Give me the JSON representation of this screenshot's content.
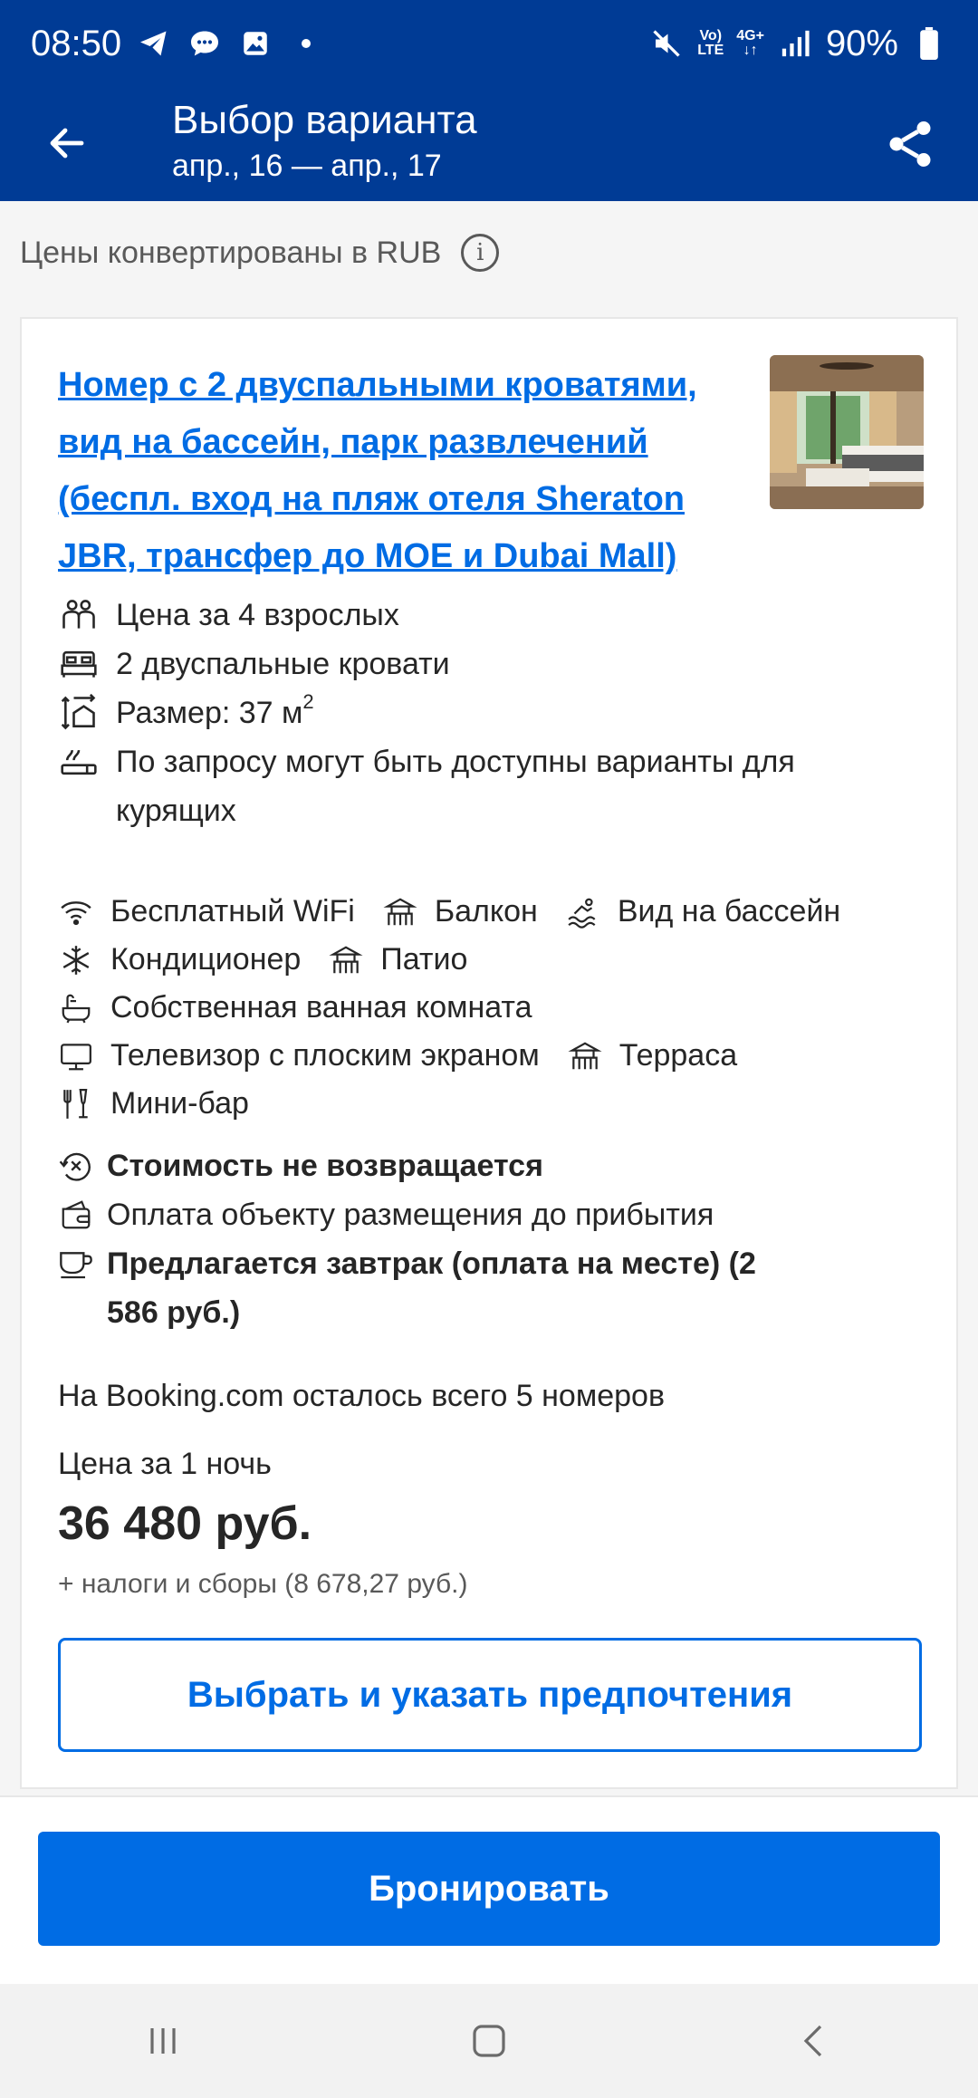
{
  "status_bar": {
    "time": "08:50",
    "network_top": "Vo)",
    "network_bottom": "LTE",
    "data_top": "4G+",
    "battery": "90%"
  },
  "app_bar": {
    "title": "Выбор варианта",
    "dates": "апр., 16 — апр., 17"
  },
  "currency_note": "Цены конвертированы в RUB",
  "room": {
    "title": "Номер с 2 двуспальными кроватями, вид на бассейн, парк развлечений (беспл. вход на пляж отеля Sheraton JBR, трансфер до MOE и Dubai Mall)",
    "features": {
      "guests": "Цена за 4 взрослых",
      "beds": "2 двуспальные кровати",
      "size_prefix": "Размер: 37 м",
      "size_sup": "2",
      "smoking": "По запросу могут быть доступны варианты для курящих"
    },
    "amenities": {
      "wifi": "Бесплатный WiFi",
      "balcony": "Балкон",
      "pool_view": "Вид на бассейн",
      "ac": "Кондиционер",
      "patio": "Патио",
      "bathroom": "Собственная ванная комната",
      "tv": "Телевизор с плоским экраном",
      "terrace": "Терраса",
      "minibar": "Мини-бар"
    },
    "policies": {
      "refund": "Стоимость не возвращается",
      "payment": "Оплата объекту размещения до прибытия",
      "breakfast": "Предлагается завтрак (оплата на месте) (2 586 руб.)"
    },
    "availability": "На Booking.com осталось всего 5 номеров",
    "price_label": "Цена за 1 ночь",
    "price": "36 480 руб.",
    "taxes": "+ налоги и сборы (8 678,27 руб.)",
    "select_button": "Выбрать и указать предпочтения"
  },
  "book_button": "Бронировать",
  "colors": {
    "brand_dark": "#003b95",
    "action_blue": "#006ce4"
  }
}
